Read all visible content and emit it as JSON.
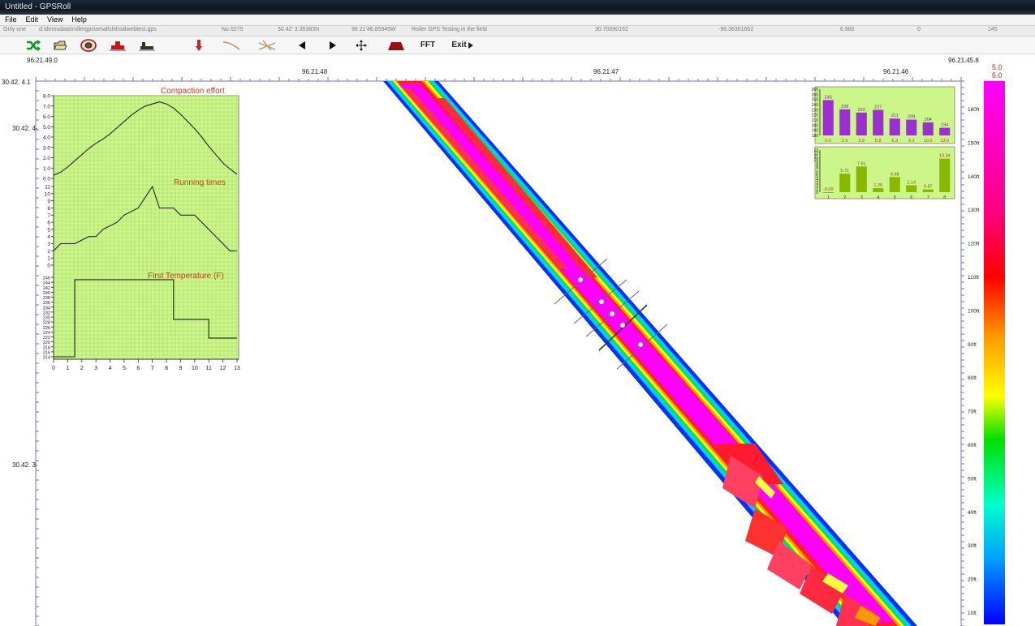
{
  "window": {
    "title": "Untitled - GPSRoll"
  },
  "menu": [
    "File",
    "Edit",
    "View",
    "Help"
  ],
  "status": {
    "mode": "Only one",
    "file": "d:\\demodata\\rollergps\\smallshit\\stilwebtest.gps",
    "record": "No.5275",
    "lat": "30.42' 3.35383N",
    "lon": "96 21'46.85949W",
    "project": "Roller GPS Testing in the field",
    "v1": "30.70090162",
    "v2": "-96.36301652",
    "v3": "6.980",
    "v4": "0",
    "v5": "245"
  },
  "toolbar": {
    "icons": [
      "shuffle-icon",
      "open-folder-icon",
      "record-disc-icon",
      "roller-red-icon",
      "roller-dark-icon",
      "pin-down-icon",
      "curve-icon",
      "cross-lines-icon",
      "prev-arrow-icon",
      "next-arrow-icon",
      "pan-arrows-icon",
      "roller-drum-icon"
    ],
    "fft_label": "FFT",
    "exit_label": "Exit"
  },
  "map": {
    "top_left_label": "96.21.49.0",
    "top_right_label": "96.21.45.8",
    "left_top_label": "30.42. 4.1",
    "x_ticks": [
      "96.21.48",
      "96.21.47",
      "96.21.46"
    ],
    "y_ticks": [
      "30.42. 4-",
      "30.42. 3-"
    ],
    "right_axis_ticks": [
      "160ft",
      "150ft",
      "140ft",
      "130ft",
      "120ft",
      "110ft",
      "100ft",
      "90ft",
      "80ft",
      "70ft",
      "60ft",
      "50ft",
      "40ft",
      "30ft",
      "20ft",
      "10ft"
    ],
    "colorbar_max_1": "5.0",
    "colorbar_max_2": "5.0",
    "colors": {
      "magenta": "#ff00ff",
      "red": "#ff2020",
      "orange": "#ff9900",
      "yellow": "#ffff00",
      "green": "#00e060",
      "cyan": "#00d0ff",
      "blue": "#0030ff",
      "panel_bg": "#ccf58a",
      "grid_green": "#9ad460"
    }
  },
  "chart_data": [
    {
      "type": "line",
      "title": "Compaction effort",
      "ylim": [
        0,
        8
      ],
      "y_ticks": [
        "8.0",
        "7.0",
        "6.0",
        "5.0",
        "4.0",
        "3.0",
        "2.0",
        "1.0",
        "0.0"
      ],
      "x": [
        0,
        0.5,
        1,
        1.5,
        2,
        2.5,
        3,
        3.5,
        4,
        4.5,
        5,
        5.5,
        6,
        6.5,
        7,
        7.5,
        8,
        8.5,
        9,
        9.5,
        10,
        10.5,
        11,
        11.5,
        12,
        12.5,
        13
      ],
      "values": [
        0.3,
        0.6,
        1.1,
        1.7,
        2.3,
        2.9,
        3.4,
        3.8,
        4.3,
        4.9,
        5.5,
        6.1,
        6.6,
        7.0,
        7.2,
        7.4,
        7.2,
        6.8,
        6.2,
        5.5,
        4.8,
        4.0,
        3.1,
        2.3,
        1.5,
        0.9,
        0.4
      ]
    },
    {
      "type": "line",
      "title": "Running times",
      "ylim": [
        0,
        11
      ],
      "y_ticks": [
        "11",
        "10",
        "9",
        "8",
        "7",
        "6",
        "5",
        "4",
        "3",
        "2",
        "1",
        "0"
      ],
      "x": [
        0,
        0.5,
        1.5,
        2.5,
        3,
        3.5,
        4.5,
        5,
        6,
        7,
        7.5,
        8.5,
        9,
        10,
        10.5,
        11,
        11.5,
        12,
        12.5,
        13
      ],
      "values": [
        2,
        3,
        3,
        4,
        4,
        5,
        6,
        7,
        8,
        11,
        8,
        8,
        7,
        7,
        6,
        5,
        4,
        3,
        2,
        2
      ]
    },
    {
      "type": "line",
      "title": "First Temperature (F)",
      "ylim": [
        214,
        248
      ],
      "y_ticks": [
        "246",
        "244",
        "242",
        "240",
        "238",
        "236",
        "234",
        "232",
        "230",
        "228",
        "226",
        "224",
        "222",
        "220",
        "218",
        "216",
        "214"
      ],
      "x": [
        0,
        1.5,
        1.5,
        8.5,
        8.5,
        11,
        11,
        13
      ],
      "values": [
        214,
        214,
        247,
        247,
        230,
        230,
        222,
        222
      ],
      "x_ticks": [
        "0",
        "1",
        "2",
        "3",
        "4",
        "5",
        "6",
        "7",
        "8",
        "9",
        "10",
        "11",
        "12",
        "13"
      ]
    },
    {
      "type": "bar",
      "categories": [
        "0.0",
        "2.6",
        "3.9",
        "5.8",
        "6.3",
        "9.2",
        "10.0",
        "13.9"
      ],
      "values": [
        245,
        228,
        222,
        227,
        211,
        209,
        204,
        194
      ],
      "ylim": [
        180,
        265
      ],
      "y_ticks": [
        "265",
        "260",
        "250",
        "240",
        "230",
        "220",
        "210",
        "200",
        "190",
        "180"
      ]
    },
    {
      "type": "bar",
      "categories": [
        "1",
        "2",
        "3",
        "4",
        "5",
        "6",
        "7",
        "8"
      ],
      "values": [
        -0.09,
        5.71,
        7.91,
        1.25,
        4.68,
        2.14,
        0.87,
        10.34
      ],
      "ylim": [
        0,
        13
      ],
      "y_ticks": [
        "13",
        "12",
        "11",
        "10",
        "9",
        "8",
        "7",
        "6",
        "5",
        "4",
        "3",
        "2",
        "1",
        "0"
      ]
    }
  ]
}
